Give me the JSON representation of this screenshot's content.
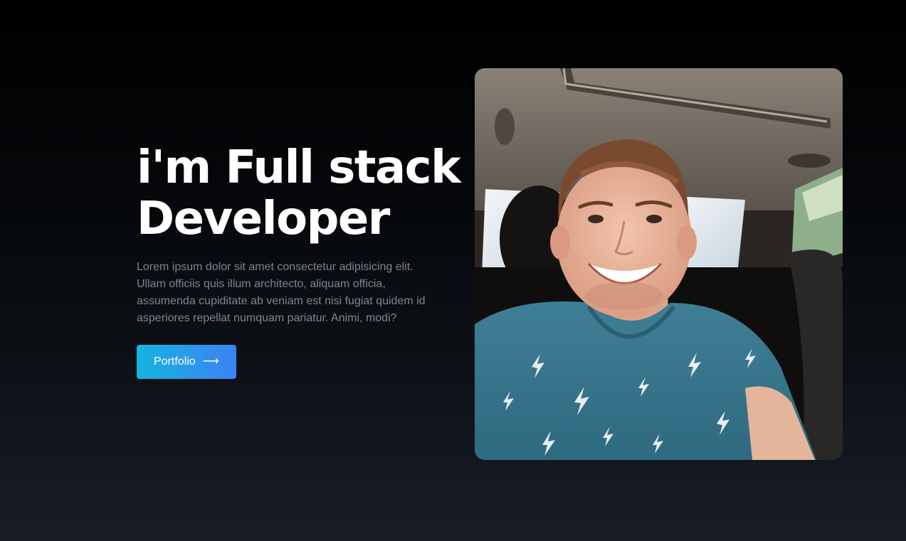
{
  "hero": {
    "title_line1": "i'm Full stack",
    "title_line2": "Developer",
    "description": "Lorem ipsum dolor sit amet consectetur adipisicing elit. Ullam officiis quis illum architecto, aliquam officia, assumenda cupiditate ab veniam est nisi fugiat quidem id asperiores repellat numquam pariatur. Animi, modi?",
    "button_label": "Portfolio",
    "button_icon": "arrow-right-icon"
  },
  "colors": {
    "title": "#ffffff",
    "description": "#7d8593",
    "button_gradient_start": "#14b4de",
    "button_gradient_end": "#3d82f6",
    "background_top": "#000000",
    "background_bottom": "#181d27"
  }
}
